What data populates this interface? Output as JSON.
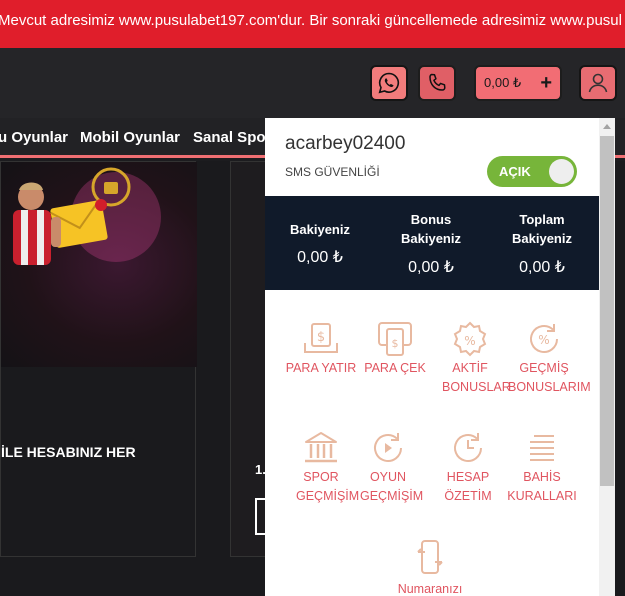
{
  "announcement": "Mevcut adresimiz www.pusulabet197.com'dur. Bir sonraki güncellemede adresimiz www.pusul",
  "header": {
    "balance": "0,00 ₺",
    "add_symbol": "+"
  },
  "nav": {
    "items": [
      "u Oyunlar",
      "Mobil Oyunlar",
      "Sanal Spor"
    ]
  },
  "content": {
    "promo_text": "İLE HESABINIZ HER",
    "card2_text": "1."
  },
  "panel": {
    "username": "acarbey02400",
    "sms_label": "SMS GÜVENLİĞİ",
    "toggle_label": "AÇIK",
    "balances": [
      {
        "label": "Bakiyeniz",
        "value": "0,00 ₺"
      },
      {
        "label": "Bonus Bakiyeniz",
        "value": "0,00 ₺"
      },
      {
        "label": "Toplam Bakiyeniz",
        "value": "0,00 ₺"
      }
    ],
    "tiles": [
      {
        "label": "PARA YATIR",
        "icon": "deposit-icon"
      },
      {
        "label": "PARA ÇEK",
        "icon": "withdraw-icon"
      },
      {
        "label": "AKTİF BONUSLAR",
        "icon": "bonus-icon"
      },
      {
        "label": "GEÇMİŞ BONUSLARIM",
        "icon": "bonus-history-icon"
      },
      {
        "label": "SPOR GEÇMİŞİM",
        "icon": "stadium-icon"
      },
      {
        "label": "OYUN GEÇMİŞİM",
        "icon": "game-history-icon"
      },
      {
        "label": "HESAP ÖZETİM",
        "icon": "clock-icon"
      },
      {
        "label": "BAHİS KURALLARI",
        "icon": "rules-list-icon"
      },
      {
        "label": "Numaranızı",
        "icon": "phone-change-icon"
      }
    ]
  },
  "colors": {
    "accent": "#e05560",
    "announcement_bg": "#e01e2b",
    "toggle_on": "#77b53a",
    "balance_bg": "#101a2a"
  }
}
